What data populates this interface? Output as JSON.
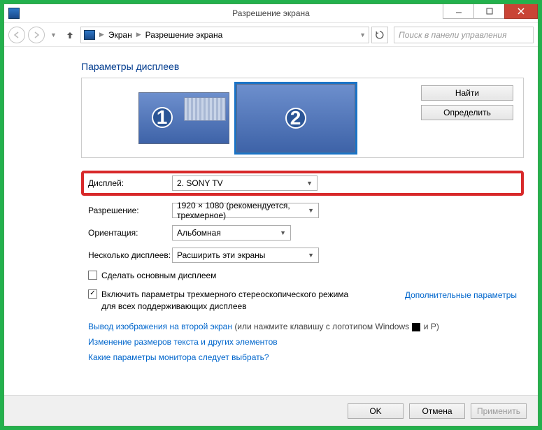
{
  "window": {
    "title": "Разрешение экрана"
  },
  "breadcrumb": {
    "item1": "Экран",
    "item2": "Разрешение экрана"
  },
  "search": {
    "placeholder": "Поиск в панели управления"
  },
  "section_title": "Параметры дисплеев",
  "display_preview": {
    "num1": "1",
    "num2": "2"
  },
  "panel_buttons": {
    "find": "Найти",
    "identify": "Определить"
  },
  "fields": {
    "display_label": "Дисплей:",
    "display_value": "2. SONY TV",
    "resolution_label": "Разрешение:",
    "resolution_value": "1920 × 1080 (рекомендуется, трехмерное)",
    "orientation_label": "Ориентация:",
    "orientation_value": "Альбомная",
    "multi_label": "Несколько дисплеев:",
    "multi_value": "Расширить эти экраны"
  },
  "checkboxes": {
    "make_primary": "Сделать основным дисплеем",
    "stereo": "Включить параметры трехмерного стереоскопического режима для всех поддерживающих дисплеев"
  },
  "advanced_link": "Дополнительные параметры",
  "links": {
    "project_prefix": "Вывод изображения на второй экран",
    "project_suffix": " (или нажмите клавишу с логотипом Windows ",
    "project_tail": " и P)",
    "text_size": "Изменение размеров текста и других элементов",
    "which_monitor": "Какие параметры монитора следует выбрать?"
  },
  "footer": {
    "ok": "OK",
    "cancel": "Отмена",
    "apply": "Применить"
  }
}
